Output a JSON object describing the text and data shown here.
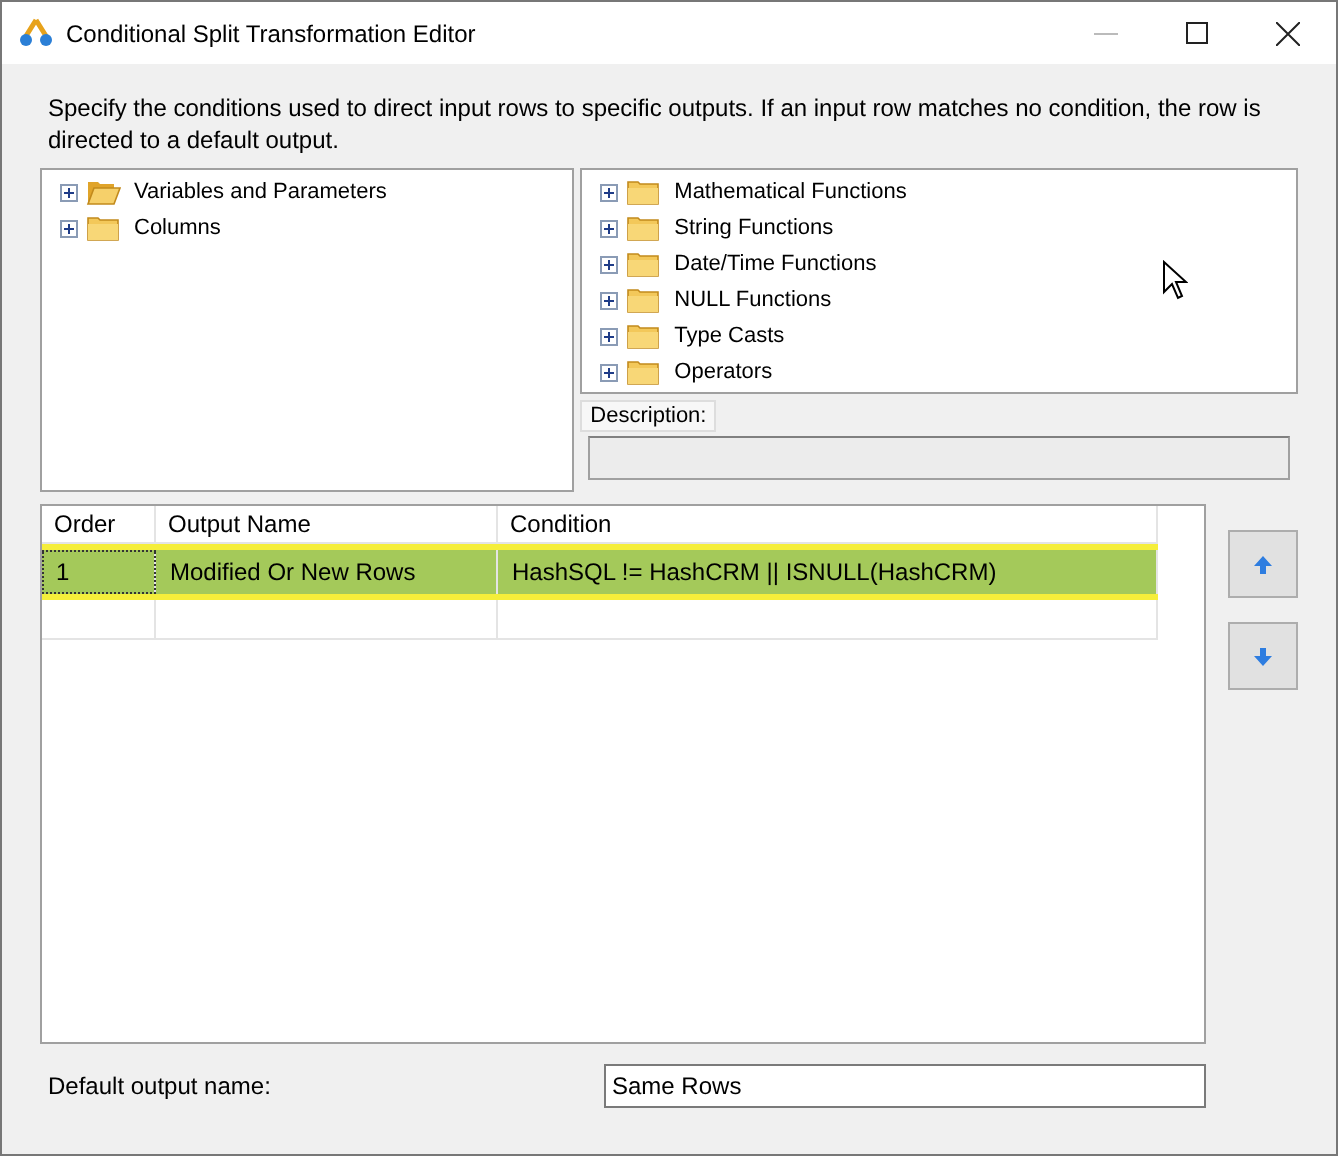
{
  "window": {
    "title": "Conditional Split Transformation Editor"
  },
  "intro": "Specify the conditions used to direct input rows to specific outputs. If an input row matches no condition, the row is directed to a default output.",
  "input_tree": [
    {
      "label": "Variables and Parameters",
      "expanded": false,
      "folder_open": true
    },
    {
      "label": "Columns",
      "expanded": false,
      "folder_open": false
    }
  ],
  "function_tree": [
    {
      "label": "Mathematical Functions",
      "expanded": false
    },
    {
      "label": "String Functions",
      "expanded": false
    },
    {
      "label": "Date/Time Functions",
      "expanded": false
    },
    {
      "label": "NULL Functions",
      "expanded": false
    },
    {
      "label": "Type Casts",
      "expanded": false
    },
    {
      "label": "Operators",
      "expanded": false
    }
  ],
  "description": {
    "label": "Description:"
  },
  "table": {
    "columns": [
      "Order",
      "Output Name",
      "Condition"
    ],
    "rows": [
      {
        "cells": [
          "1",
          "Modified Or New Rows",
          "HashSQL != HashCRM || ISNULL(HashCRM)"
        ],
        "selected": true
      }
    ]
  },
  "default_output": {
    "label": "Default output name:",
    "value": "Same Rows"
  }
}
